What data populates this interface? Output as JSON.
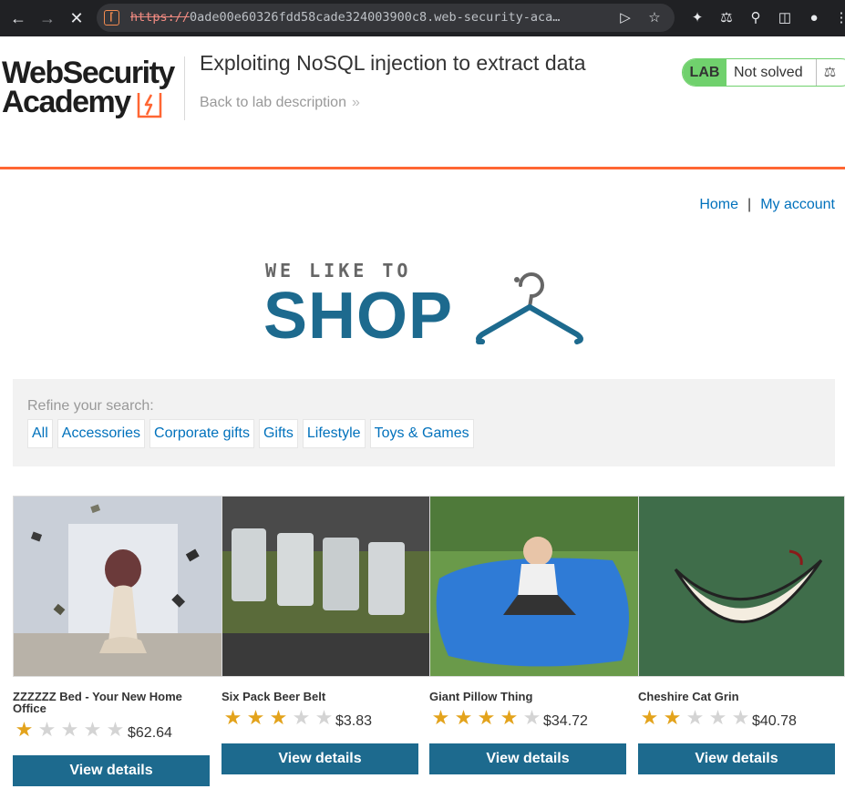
{
  "browser": {
    "url_scheme": "https://",
    "url_rest": "0ade00e60326fdd58cade324003900c8.web-security-aca…"
  },
  "academy": {
    "logo_line1": "WebSecurity",
    "logo_line2": "Academy",
    "lab_title": "Exploiting NoSQL injection to extract data",
    "back_link": "Back to lab description",
    "lab_label": "LAB",
    "lab_status": "Not solved"
  },
  "shop": {
    "nav": {
      "home": "Home",
      "separator": "|",
      "account": "My account"
    },
    "logo_top": "WE LIKE TO",
    "logo_main": "SHOP",
    "refine_label": "Refine your search:",
    "filters": [
      "All",
      "Accessories",
      "Corporate gifts",
      "Gifts",
      "Lifestyle",
      "Toys & Games"
    ]
  },
  "products": [
    {
      "name": "ZZZZZZ Bed - Your New Home Office",
      "rating": 1,
      "price": "$62.64",
      "button": "View details"
    },
    {
      "name": "Six Pack Beer Belt",
      "rating": 3,
      "price": "$3.83",
      "button": "View details"
    },
    {
      "name": "Giant Pillow Thing",
      "rating": 4,
      "price": "$34.72",
      "button": "View details"
    },
    {
      "name": "Cheshire Cat Grin",
      "rating": 2,
      "price": "$40.78",
      "button": "View details"
    }
  ],
  "colors": {
    "accent_orange": "#ff6633",
    "lab_green": "#70d16d",
    "shop_blue": "#1d6a8e",
    "link_blue": "#0071bc",
    "star_gold": "#e3a31c"
  }
}
